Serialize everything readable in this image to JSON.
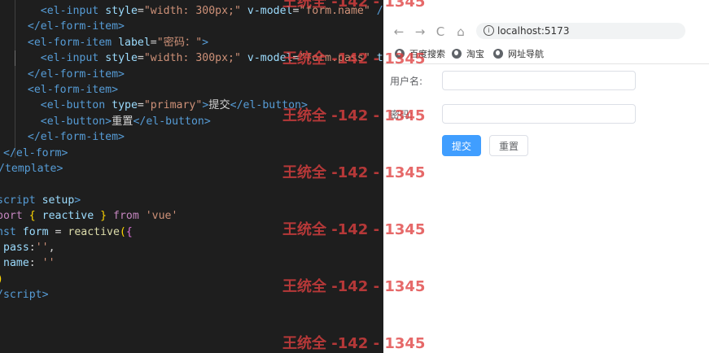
{
  "editor": {
    "lines": [
      [
        {
          "c": "t-pl",
          "t": "    "
        },
        {
          "c": "t-tag",
          "t": "<el-input"
        },
        {
          "c": "t-pl",
          "t": " "
        },
        {
          "c": "t-attr",
          "t": "style"
        },
        {
          "c": "t-pl",
          "t": "="
        },
        {
          "c": "t-str",
          "t": "\"width: 300px;\""
        },
        {
          "c": "t-pl",
          "t": " "
        },
        {
          "c": "t-attr",
          "t": "v-model"
        },
        {
          "c": "t-pl",
          "t": "="
        },
        {
          "c": "t-str",
          "t": "\"form.name\""
        },
        {
          "c": "t-pl",
          "t": " "
        },
        {
          "c": "t-tag",
          "t": "/>"
        }
      ],
      [
        {
          "c": "t-pl",
          "t": "  "
        },
        {
          "c": "t-tag",
          "t": "</el-form-item>"
        }
      ],
      [
        {
          "c": "t-pl",
          "t": "  "
        },
        {
          "c": "t-tag",
          "t": "<el-form-item"
        },
        {
          "c": "t-pl",
          "t": " "
        },
        {
          "c": "t-attr",
          "t": "label"
        },
        {
          "c": "t-pl",
          "t": "="
        },
        {
          "c": "t-str",
          "t": "\"密码：\""
        },
        {
          "c": "t-tag",
          "t": ">"
        }
      ],
      [
        {
          "c": "t-pl",
          "t": "    "
        },
        {
          "c": "t-tag",
          "t": "<el-input"
        },
        {
          "c": "t-pl",
          "t": " "
        },
        {
          "c": "t-attr",
          "t": "style"
        },
        {
          "c": "t-pl",
          "t": "="
        },
        {
          "c": "t-str",
          "t": "\"width: 300px;\""
        },
        {
          "c": "t-pl",
          "t": " "
        },
        {
          "c": "t-attr",
          "t": "v-model"
        },
        {
          "c": "t-pl",
          "t": "="
        },
        {
          "c": "t-str",
          "t": "\"form.pass\""
        },
        {
          "c": "t-pl",
          "t": " "
        },
        {
          "c": "t-attr",
          "t": "type"
        }
      ],
      [
        {
          "c": "t-pl",
          "t": "  "
        },
        {
          "c": "t-tag",
          "t": "</el-form-item>"
        }
      ],
      [
        {
          "c": "t-pl",
          "t": "  "
        },
        {
          "c": "t-tag",
          "t": "<el-form-item>"
        }
      ],
      [
        {
          "c": "t-pl",
          "t": "    "
        },
        {
          "c": "t-tag",
          "t": "<el-button"
        },
        {
          "c": "t-pl",
          "t": " "
        },
        {
          "c": "t-attr",
          "t": "type"
        },
        {
          "c": "t-pl",
          "t": "="
        },
        {
          "c": "t-str",
          "t": "\"primary\""
        },
        {
          "c": "t-tag",
          "t": ">"
        },
        {
          "c": "t-pl",
          "t": "提交"
        },
        {
          "c": "t-tag",
          "t": "</el-button>"
        }
      ],
      [
        {
          "c": "t-pl",
          "t": "    "
        },
        {
          "c": "t-tag",
          "t": "<el-button>"
        },
        {
          "c": "t-pl",
          "t": "重置"
        },
        {
          "c": "t-tag",
          "t": "</el-button>"
        }
      ],
      [
        {
          "c": "t-pl",
          "t": "  "
        },
        {
          "c": "t-tag",
          "t": "</el-form-item>"
        }
      ],
      [
        {
          "c": "t-tag",
          "t": "</el-form>"
        }
      ],
      [
        {
          "c": "t-tag",
          "t": "/template>"
        }
      ],
      [],
      [
        {
          "c": "t-tag",
          "t": "script"
        },
        {
          "c": "t-pl",
          "t": " "
        },
        {
          "c": "t-attr",
          "t": "setup"
        },
        {
          "c": "t-tag",
          "t": ">"
        }
      ],
      [
        {
          "c": "t-ctl",
          "t": "port"
        },
        {
          "c": "t-pl",
          "t": " "
        },
        {
          "c": "t-br",
          "t": "{"
        },
        {
          "c": "t-pl",
          "t": " "
        },
        {
          "c": "t-var",
          "t": "reactive"
        },
        {
          "c": "t-pl",
          "t": " "
        },
        {
          "c": "t-br",
          "t": "}"
        },
        {
          "c": "t-pl",
          "t": " "
        },
        {
          "c": "t-ctl",
          "t": "from"
        },
        {
          "c": "t-pl",
          "t": " "
        },
        {
          "c": "t-str",
          "t": "'vue'"
        }
      ],
      [
        {
          "c": "t-kw",
          "t": "nst"
        },
        {
          "c": "t-pl",
          "t": " "
        },
        {
          "c": "t-var",
          "t": "form"
        },
        {
          "c": "t-pl",
          "t": " = "
        },
        {
          "c": "t-fn",
          "t": "reactive"
        },
        {
          "c": "t-br",
          "t": "("
        },
        {
          "c": "t-br2",
          "t": "{"
        }
      ],
      [
        {
          "c": "t-var",
          "t": "pass"
        },
        {
          "c": "t-pl",
          "t": ":"
        },
        {
          "c": "t-str",
          "t": "''"
        },
        {
          "c": "t-pl",
          "t": ","
        }
      ],
      [
        {
          "c": "t-var",
          "t": "name"
        },
        {
          "c": "t-pl",
          "t": ": "
        },
        {
          "c": "t-str",
          "t": "''"
        }
      ],
      [
        {
          "c": "t-br",
          "t": ")"
        }
      ],
      [
        {
          "c": "t-tag",
          "t": "/script>"
        }
      ]
    ]
  },
  "browser": {
    "nav": {
      "back_icon": "←",
      "forward_icon": "→",
      "reload_icon": "C",
      "home_icon": "⌂",
      "info_icon": "i",
      "url": "localhost:5173"
    },
    "bookmarks": [
      {
        "label": "百度搜索"
      },
      {
        "label": "淘宝"
      },
      {
        "label": "网址导航"
      }
    ],
    "form": {
      "username_label": "用户名:",
      "password_label": "密码:",
      "username_value": "",
      "password_value": "",
      "submit_label": "提交",
      "reset_label": "重置"
    }
  },
  "watermark": {
    "text": "王统全 -142 - 1345"
  },
  "colors": {
    "editor_bg": "#1e1e1e",
    "primary": "#409eff",
    "watermark": "#e04040"
  }
}
